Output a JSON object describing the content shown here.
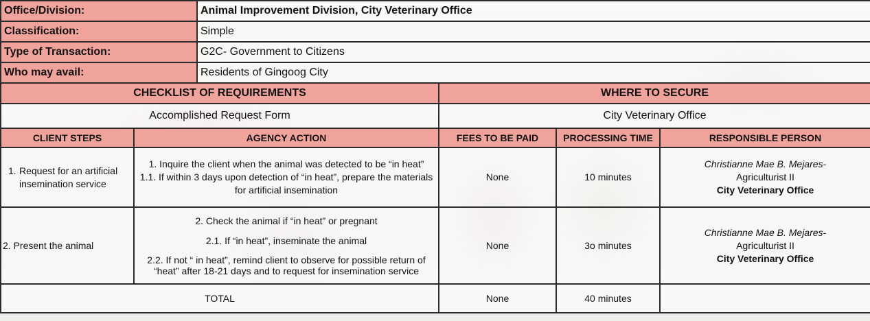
{
  "info": {
    "office_label": "Office/Division:",
    "office_value": "Animal Improvement Division, City Veterinary Office",
    "classification_label": "Classification:",
    "classification_value": "Simple",
    "transaction_label": "Type of Transaction:",
    "transaction_value": "G2C- Government to Citizens",
    "avail_label": "Who may avail:",
    "avail_value": "Residents of Gingoog City"
  },
  "requirements": {
    "checklist_header": "CHECKLIST OF REQUIREMENTS",
    "where_header": "WHERE TO SECURE",
    "item": "Accomplished Request Form",
    "where": "City Veterinary Office"
  },
  "columns": {
    "client_steps": "CLIENT STEPS",
    "agency_action": "AGENCY ACTION",
    "fees": "FEES TO BE PAID",
    "processing_time": "PROCESSING TIME",
    "responsible": "RESPONSIBLE PERSON"
  },
  "steps": [
    {
      "num": "1.",
      "client": "Request for an artificial insemination service",
      "actions": [
        "1.  Inquire the client when the animal was detected to be “in heat”",
        "1.1. If within 3 days upon detection of “in heat”, prepare the materials for artificial insemination"
      ],
      "fees": "None",
      "time": "10 minutes",
      "person_name": "Christianne Mae B. Mejares-",
      "person_title": "Agriculturist II",
      "person_org": "City Veterinary Office"
    },
    {
      "client": "2. Present the animal",
      "actions": [
        "2. Check the animal if “in heat” or pregnant",
        "2.1. If “in heat”, inseminate the animal",
        "2.2. If  not “ in heat”, remind client to observe for possible return of “heat” after 18-21 days and to request for insemination service"
      ],
      "fees": "None",
      "time": "3o minutes",
      "person_name": "Christianne Mae B. Mejares-",
      "person_title": "Agriculturist II",
      "person_org": "City Veterinary Office"
    }
  ],
  "total": {
    "label": "TOTAL",
    "fees": "None",
    "time": "40 minutes"
  },
  "colors": {
    "header_fill": "#f0a39b",
    "border": "#2b2b2b"
  }
}
